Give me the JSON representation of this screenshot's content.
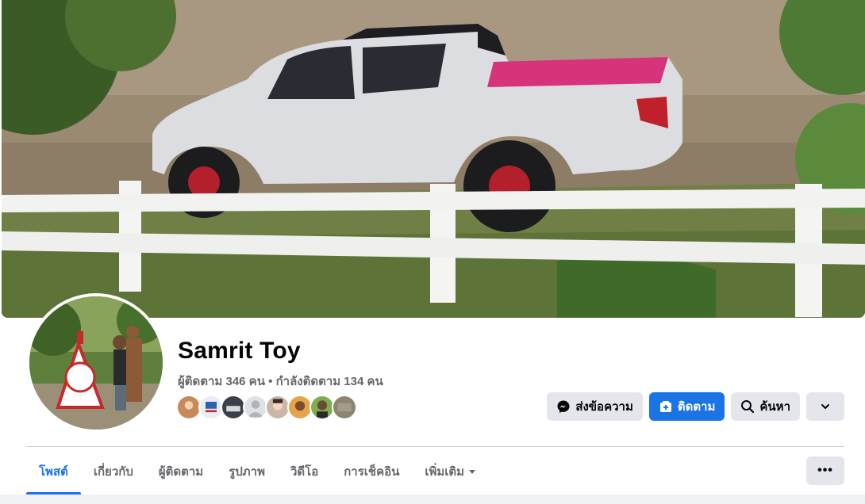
{
  "profile": {
    "name": "Samrit Toy",
    "followers_text": "ผู้ติดตาม 346 คน",
    "separator": " • ",
    "following_text": "กำลังติดตาม 134 คน"
  },
  "actions": {
    "message_label": "ส่งข้อความ",
    "follow_label": "ติดตาม",
    "search_label": "ค้นหา"
  },
  "tabs": [
    {
      "label": "โพสต์",
      "active": true
    },
    {
      "label": "เกี่ยวกับ",
      "active": false
    },
    {
      "label": "ผู้ติดตาม",
      "active": false
    },
    {
      "label": "รูปภาพ",
      "active": false
    },
    {
      "label": "วิดีโอ",
      "active": false
    },
    {
      "label": "การเช็คอิน",
      "active": false
    },
    {
      "label": "เพิ่มเติม",
      "active": false
    }
  ],
  "icons": {
    "message": "messenger-icon",
    "follow": "follow-icon",
    "search": "search-icon",
    "dropdown": "chevron-down-icon",
    "more": "more-dots-icon"
  },
  "colors": {
    "accent": "#1b74e4",
    "secondary_button": "#e4e6eb",
    "muted_text": "#65676b"
  }
}
